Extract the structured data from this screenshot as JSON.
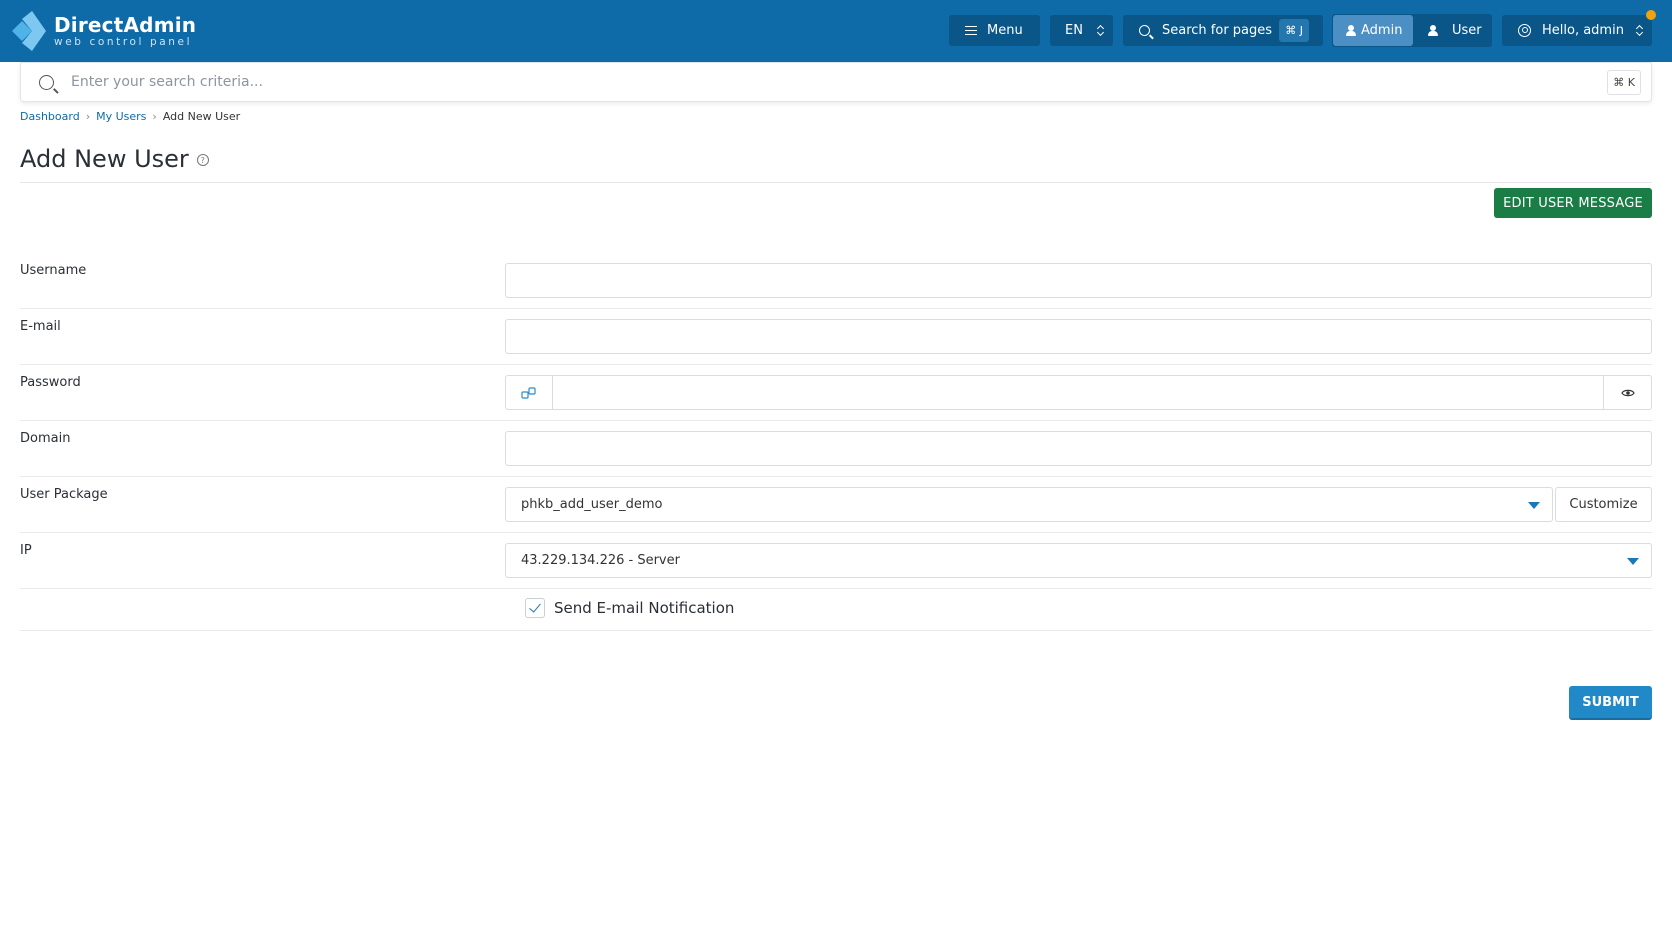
{
  "header": {
    "brand_title": "DirectAdmin",
    "brand_subtitle": "web control panel",
    "menu_label": "Menu",
    "language": "EN",
    "search_pages_label": "Search for pages",
    "search_pages_shortcut": "⌘ J",
    "role_admin_label": "Admin",
    "role_user_label": "User",
    "greeting": "Hello, admin",
    "colors": {
      "bar": "#0e6ba8",
      "notification_dot": "#f0a30a"
    }
  },
  "search": {
    "placeholder": "Enter your search criteria...",
    "shortcut": "⌘ K"
  },
  "breadcrumb": {
    "items": [
      "Dashboard",
      "My Users",
      "Add New User"
    ]
  },
  "page": {
    "title": "Add New User",
    "edit_message_button": "EDIT USER MESSAGE"
  },
  "form": {
    "username": {
      "label": "Username",
      "value": ""
    },
    "email": {
      "label": "E-mail",
      "value": ""
    },
    "password": {
      "label": "Password",
      "value": ""
    },
    "domain": {
      "label": "Domain",
      "value": ""
    },
    "user_package": {
      "label": "User Package",
      "selected": "phkb_add_user_demo",
      "customize_label": "Customize"
    },
    "ip": {
      "label": "IP",
      "selected": "43.229.134.226 - Server"
    },
    "send_notification": {
      "label": "Send E-mail Notification",
      "checked": true
    },
    "submit_label": "SUBMIT"
  }
}
